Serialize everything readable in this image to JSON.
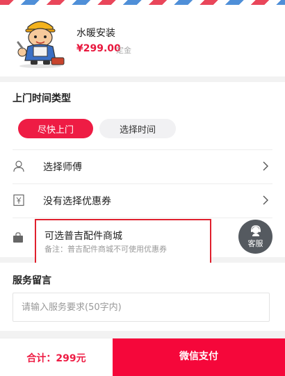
{
  "theme": {
    "accent": "#ee1c44",
    "pay_button": "#f5073a",
    "highlight_border": "#e0202e",
    "kefu_bg": "#555a60"
  },
  "product": {
    "image_icon": "worker-mascot-icon",
    "name": "水暖安装",
    "price": "¥299.00",
    "price_note": "定金"
  },
  "visit_type": {
    "title": "上门时间类型",
    "options": [
      "尽快上门",
      "选择时间"
    ],
    "selected": "尽快上门"
  },
  "rows": [
    {
      "icon": "person-icon",
      "label": "选择师傅"
    },
    {
      "icon": "coupon-icon",
      "label": "没有选择优惠券"
    }
  ],
  "accessory_mall": {
    "icon": "bag-icon",
    "title": "可选普吉配件商城",
    "note": "备注：普吉配件商城不可使用优惠券"
  },
  "kefu": {
    "icon": "customer-service-icon",
    "label": "客服"
  },
  "service_message": {
    "title": "服务留言",
    "placeholder": "请输入服务要求(50字内)",
    "value": ""
  },
  "footer": {
    "total": "合计：299元",
    "pay_label": "微信支付"
  }
}
